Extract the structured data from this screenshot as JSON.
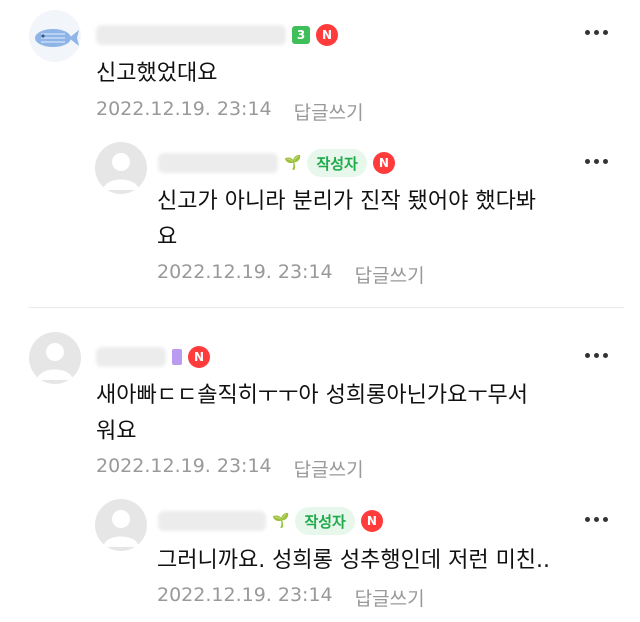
{
  "comments": [
    {
      "text": "신고했었대요",
      "timestamp": "2022.12.19. 23:14",
      "reply_label": "답글쓰기",
      "level": "3",
      "n_badge": "N",
      "replies": [
        {
          "text_line1": "신고가 아니라 분리가 진작 됐어야 했다봐",
          "text_line2": "요",
          "author_badge": "작성자",
          "n_badge": "N",
          "timestamp": "2022.12.19. 23:14",
          "reply_label": "답글쓰기"
        }
      ]
    },
    {
      "text_line1": "새아빠ㄷㄷ솔직히ㅜㅜ아 성희롱아닌가요ㅜ무서",
      "text_line2": "워요",
      "timestamp": "2022.12.19. 23:14",
      "reply_label": "답글쓰기",
      "n_badge": "N",
      "replies": [
        {
          "text": "그러니까요. 성희롱 성추행인데 저런 미친..",
          "author_badge": "작성자",
          "n_badge": "N",
          "timestamp": "2022.12.19. 23:14",
          "reply_label": "답글쓰기"
        }
      ]
    }
  ],
  "colors": {
    "n_badge": "#ff3b3b",
    "author_badge_bg": "#e7f7ec",
    "author_badge_text": "#1faa4a",
    "level_badge": "#3fbf5a",
    "meta_text": "#999999"
  },
  "icons": {
    "avatar_whale": "whale-avatar-icon",
    "avatar_default": "default-profile-icon",
    "more": "more-dots-icon"
  }
}
